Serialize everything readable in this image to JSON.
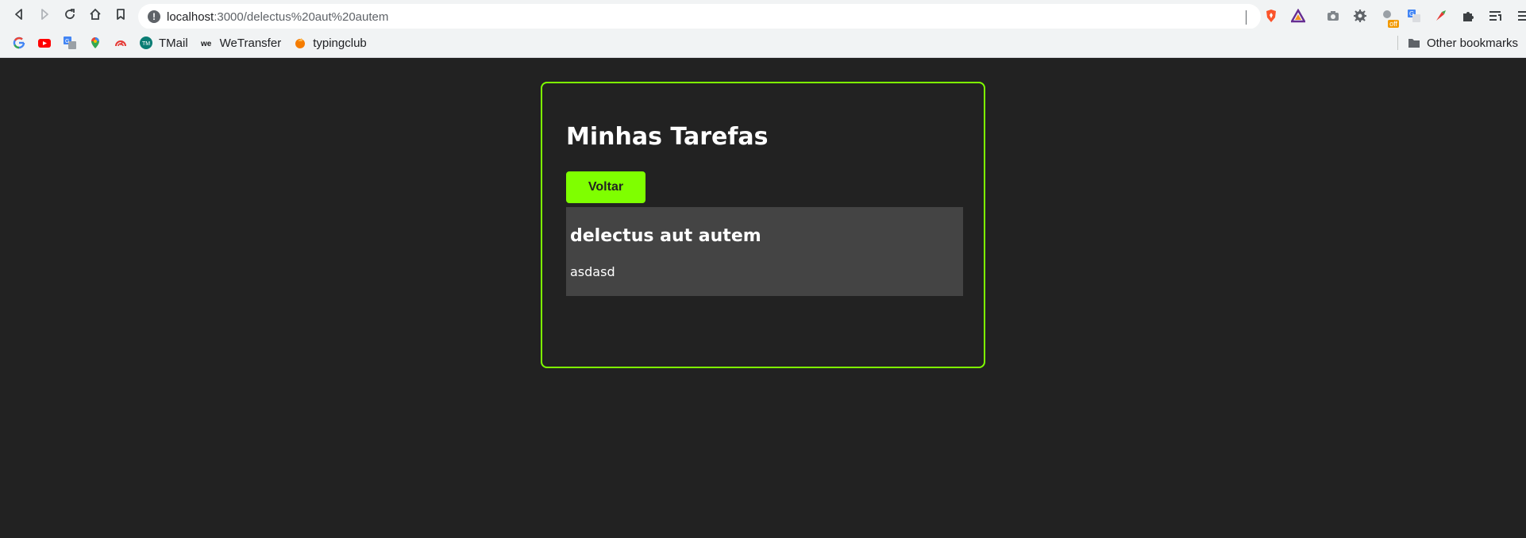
{
  "browser": {
    "url_host": "localhost",
    "url_rest": ":3000/delectus%20aut%20autem",
    "info_symbol": "!",
    "extensions": [
      "brave-shields-icon",
      "brave-rewards-icon",
      "screenshot-icon",
      "settings-gear-icon",
      "extension-off-icon",
      "translate-icon",
      "colorful-extension-icon",
      "puzzle-icon",
      "reading-list-icon",
      "menu-icon"
    ],
    "extension_badge": "off"
  },
  "bookmarks": {
    "items": [
      {
        "icon": "google-icon",
        "label": ""
      },
      {
        "icon": "youtube-icon",
        "label": ""
      },
      {
        "icon": "translate-icon",
        "label": ""
      },
      {
        "icon": "maps-icon",
        "label": ""
      },
      {
        "icon": "speedtest-icon",
        "label": ""
      },
      {
        "icon": "tmail-icon",
        "label": "TMail"
      },
      {
        "icon": "wetransfer-icon",
        "label": "WeTransfer"
      },
      {
        "icon": "typingclub-icon",
        "label": "typingclub"
      }
    ],
    "other": "Other bookmarks"
  },
  "page": {
    "title": "Minhas Tarefas",
    "back_button": "Voltar",
    "task": {
      "title": "delectus aut autem",
      "description": "asdasd"
    }
  },
  "colors": {
    "accent": "#7fff00",
    "background": "#222222",
    "task_background": "#444444"
  }
}
